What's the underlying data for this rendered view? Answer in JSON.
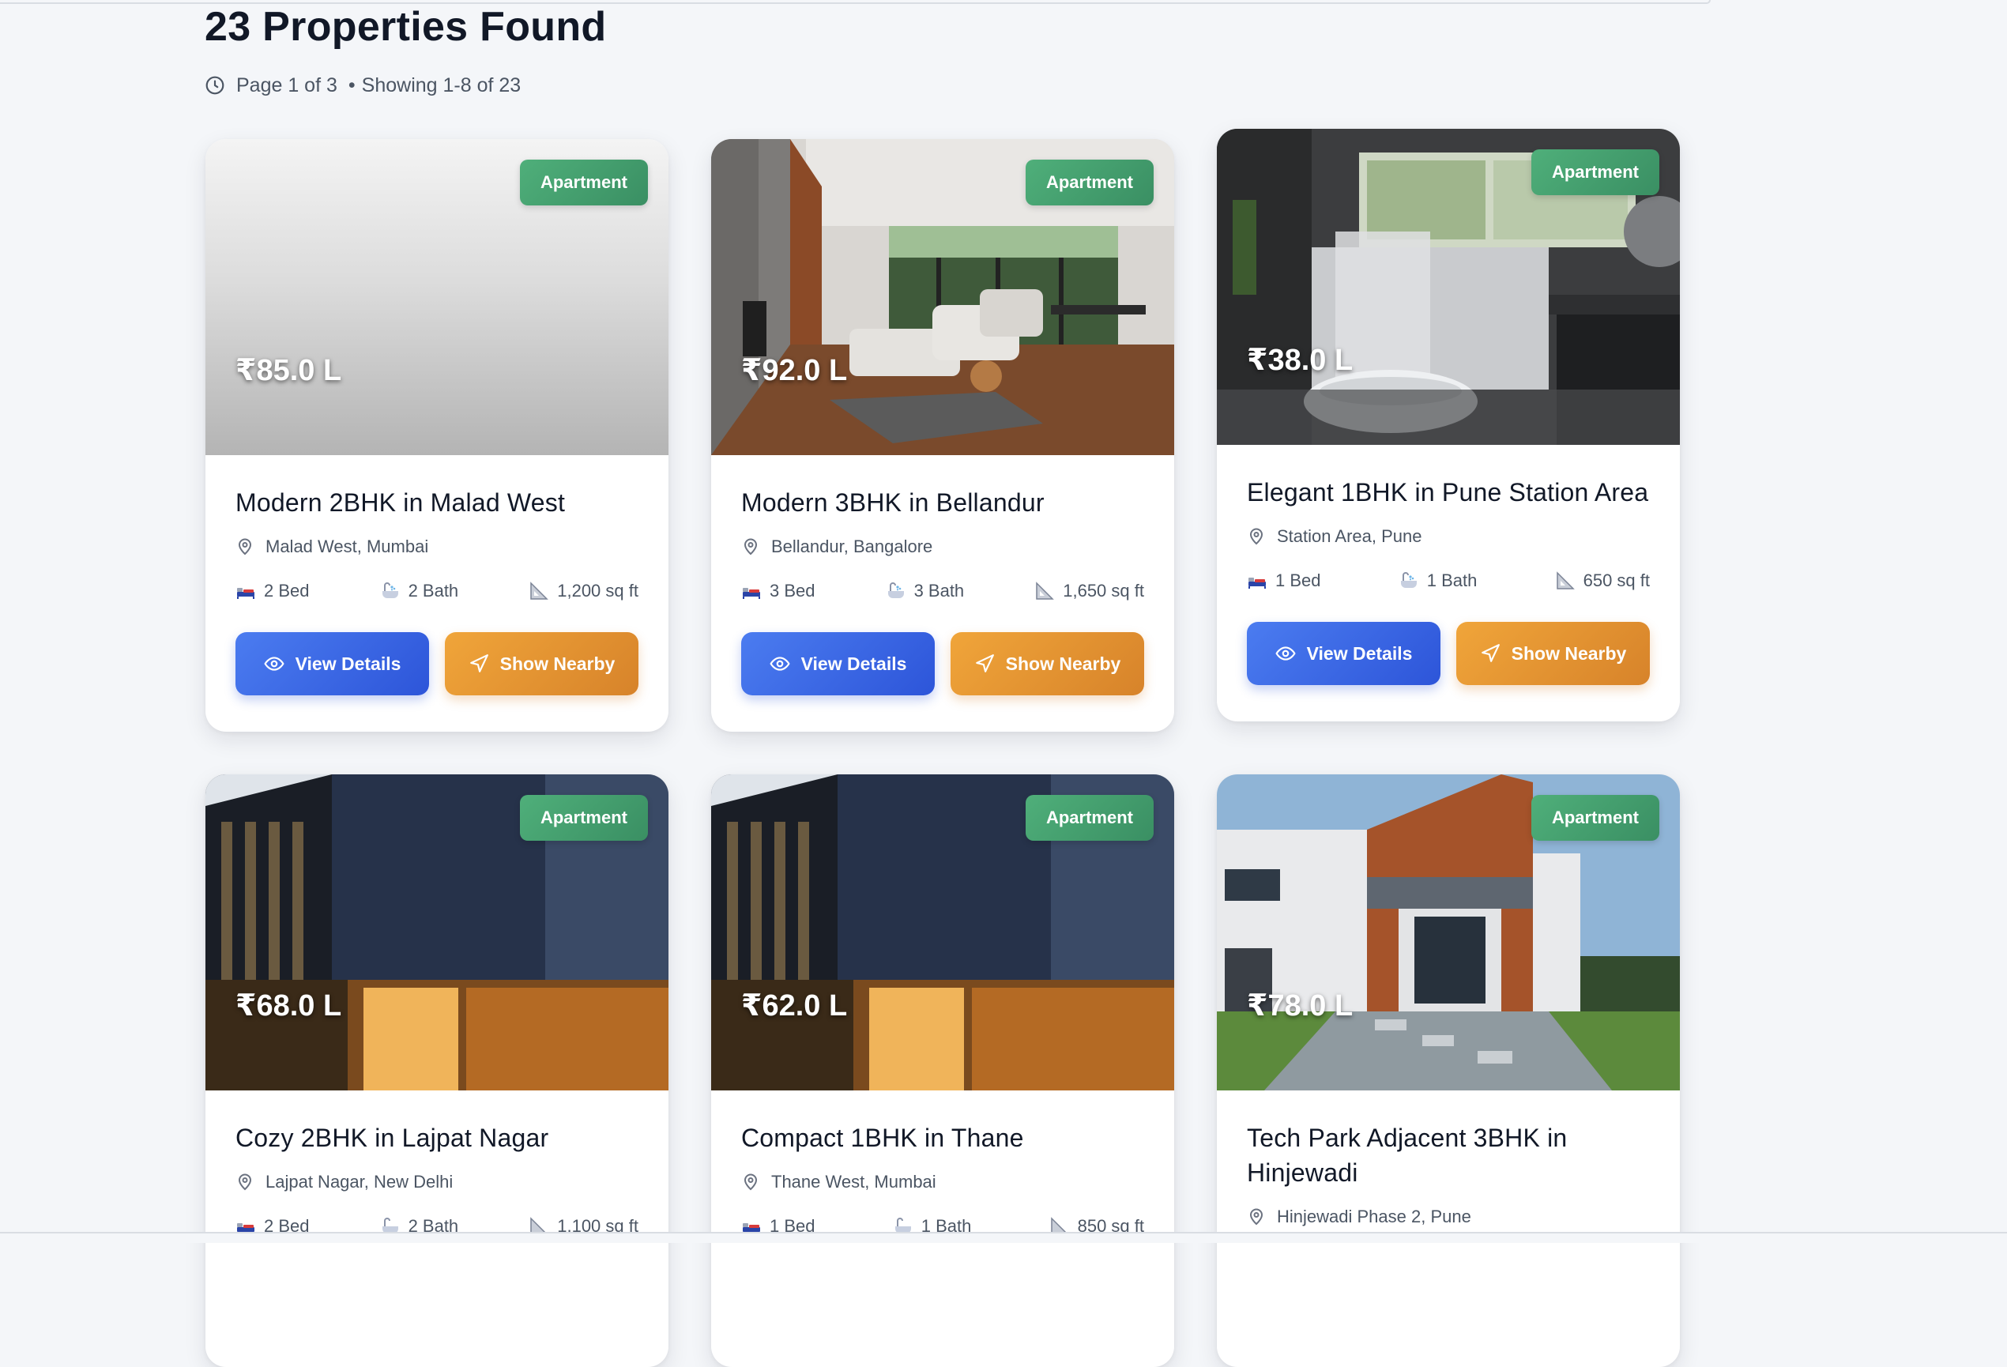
{
  "header": {
    "title": "23 Properties Found",
    "page_info": "Page 1 of 3",
    "showing": "Showing 1-8 of 23"
  },
  "buttons": {
    "view_details": "View Details",
    "show_nearby": "Show Nearby"
  },
  "colors": {
    "badge": "#3a8f63",
    "view_button": "#2d55d9",
    "nearby_button": "#d7832a"
  },
  "icons": {
    "meta": "clock-icon",
    "location": "map-pin-icon",
    "bed": "bed-icon",
    "bath": "bath-icon",
    "area": "ruler-icon",
    "view": "eye-icon",
    "nearby": "navigation-arrow-icon"
  },
  "properties": [
    {
      "type": "Apartment",
      "price": "₹85.0 L",
      "title": "Modern 2BHK in Malad West",
      "location": "Malad West, Mumbai",
      "beds": "2 Bed",
      "baths": "2 Bath",
      "area": "1,200 sq ft",
      "image": "no image (grey gradient placeholder)"
    },
    {
      "type": "Apartment",
      "price": "₹92.0 L",
      "title": "Modern 3BHK in Bellandur",
      "location": "Bellandur, Bangalore",
      "beds": "3 Bed",
      "baths": "3 Bath",
      "area": "1,650 sq ft",
      "image": "living room interior"
    },
    {
      "type": "Apartment",
      "price": "₹38.0 L",
      "title": "Elegant 1BHK in Pune Station Area",
      "location": "Station Area, Pune",
      "beds": "1 Bed",
      "baths": "1 Bath",
      "area": "650 sq ft",
      "image": "dark bathroom interior"
    },
    {
      "type": "Apartment",
      "price": "₹68.0 L",
      "title": "Cozy 2BHK in Lajpat Nagar",
      "location": "Lajpat Nagar, New Delhi",
      "beds": "2 Bed",
      "baths": "2 Bath",
      "area": "1,100 sq ft",
      "image": "modern building facade at dusk"
    },
    {
      "type": "Apartment",
      "price": "₹62.0 L",
      "title": "Compact 1BHK in Thane",
      "location": "Thane West, Mumbai",
      "beds": "1 Bed",
      "baths": "1 Bath",
      "area": "850 sq ft",
      "image": "modern building facade at dusk"
    },
    {
      "type": "Apartment",
      "price": "₹78.0 L",
      "title": "Tech Park Adjacent 3BHK in Hinjewadi",
      "location": "Hinjewadi Phase 2, Pune",
      "beds": "",
      "baths": "",
      "area": "",
      "image": "modern house exterior with lawn"
    }
  ]
}
